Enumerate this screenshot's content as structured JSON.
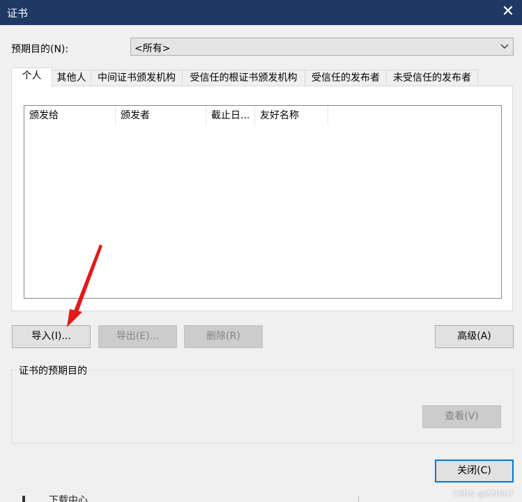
{
  "window": {
    "title": "证书",
    "close_glyph": "✕"
  },
  "purpose": {
    "label": "预期目的(N):",
    "selected": "<所有>"
  },
  "tabs": [
    {
      "label": "个人",
      "active": true
    },
    {
      "label": "其他人",
      "active": false
    },
    {
      "label": "中间证书颁发机构",
      "active": false
    },
    {
      "label": "受信任的根证书颁发机构",
      "active": false
    },
    {
      "label": "受信任的发布者",
      "active": false
    },
    {
      "label": "未受信任的发布者",
      "active": false
    }
  ],
  "list": {
    "columns": [
      "颁发给",
      "颁发者",
      "截止日...",
      "友好名称"
    ],
    "rows": []
  },
  "buttons": {
    "import": "导入(I)...",
    "export": "导出(E)...",
    "remove": "删除(R)",
    "advanced": "高级(A)",
    "view": "查看(V)",
    "close": "关闭(C)"
  },
  "group": {
    "label": "证书的预期目的"
  },
  "background_partial_text": "下载中心",
  "watermark": "CSDN @ZZDICT",
  "colors": {
    "titlebar": "#1f3864",
    "annotation_arrow": "#e3191c",
    "default_button_border": "#0078d7"
  }
}
